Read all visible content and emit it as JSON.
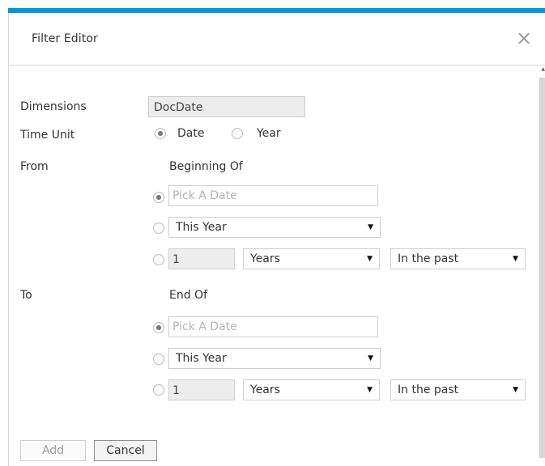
{
  "dialog": {
    "title": "Filter Editor",
    "close_icon": "close-icon"
  },
  "form": {
    "dimensions_label": "Dimensions",
    "dimensions_value": "DocDate",
    "time_unit_label": "Time Unit",
    "time_unit_options": [
      "Date",
      "Year"
    ],
    "time_unit_selected": "Date",
    "from": {
      "label": "From",
      "section_label": "Beginning Of",
      "date_placeholder": "Pick A Date",
      "period_value": "This Year",
      "offset_value": "1",
      "unit_value": "Years",
      "direction_value": "In the past",
      "selected_option": "date"
    },
    "to": {
      "label": "To",
      "section_label": "End Of",
      "date_placeholder": "Pick A Date",
      "period_value": "This Year",
      "offset_value": "1",
      "unit_value": "Years",
      "direction_value": "In the past",
      "selected_option": "date"
    }
  },
  "actions": {
    "add_label": "Add",
    "cancel_label": "Cancel"
  },
  "colors": {
    "accent": "#0a93d8",
    "text": "#333333",
    "border": "#cfcfcf"
  }
}
